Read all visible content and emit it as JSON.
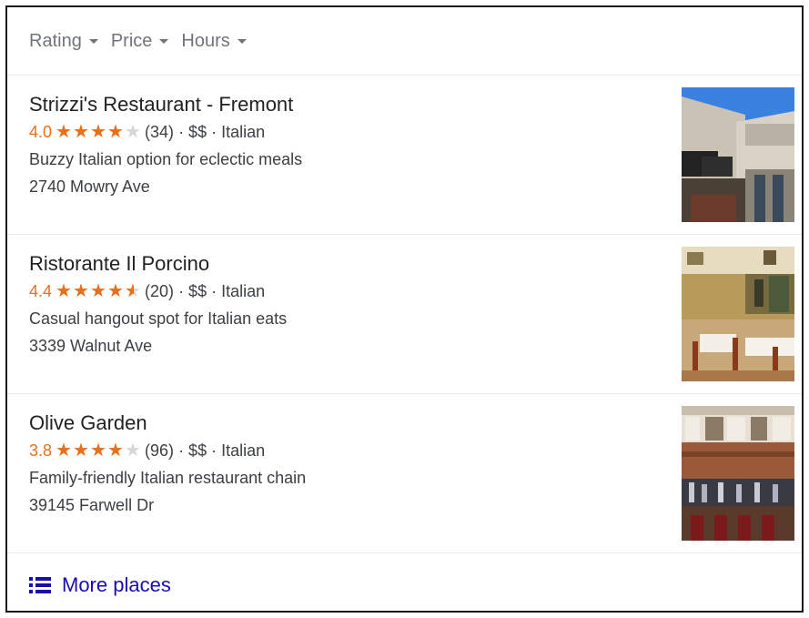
{
  "filters": [
    {
      "label": "Rating"
    },
    {
      "label": "Price"
    },
    {
      "label": "Hours"
    }
  ],
  "places": [
    {
      "name": "Strizzi's Restaurant - Fremont",
      "rating": "4.0",
      "rating_value": 4.0,
      "reviews": "(34)",
      "meta": "· $$ · Italian",
      "description": "Buzzy Italian option for eclectic meals",
      "address": "2740 Mowry Ave",
      "photo": "storefront-exterior"
    },
    {
      "name": "Ristorante Il Porcino",
      "rating": "4.4",
      "rating_value": 4.5,
      "reviews": "(20)",
      "meta": "· $$ · Italian",
      "description": "Casual hangout spot for Italian eats",
      "address": "3339 Walnut Ave",
      "photo": "dining-room-interior"
    },
    {
      "name": "Olive Garden",
      "rating": "3.8",
      "rating_value": 4.0,
      "reviews": "(96)",
      "meta": "· $$ · Italian",
      "description": "Family-friendly Italian restaurant chain",
      "address": "39145 Farwell Dr",
      "photo": "bar-interior"
    }
  ],
  "more": {
    "label": "More places",
    "icon": "list-icon"
  },
  "colors": {
    "star": "#e7711b",
    "star_empty": "#d6d6d6",
    "link": "#1a0dab",
    "filter": "#70757a"
  }
}
